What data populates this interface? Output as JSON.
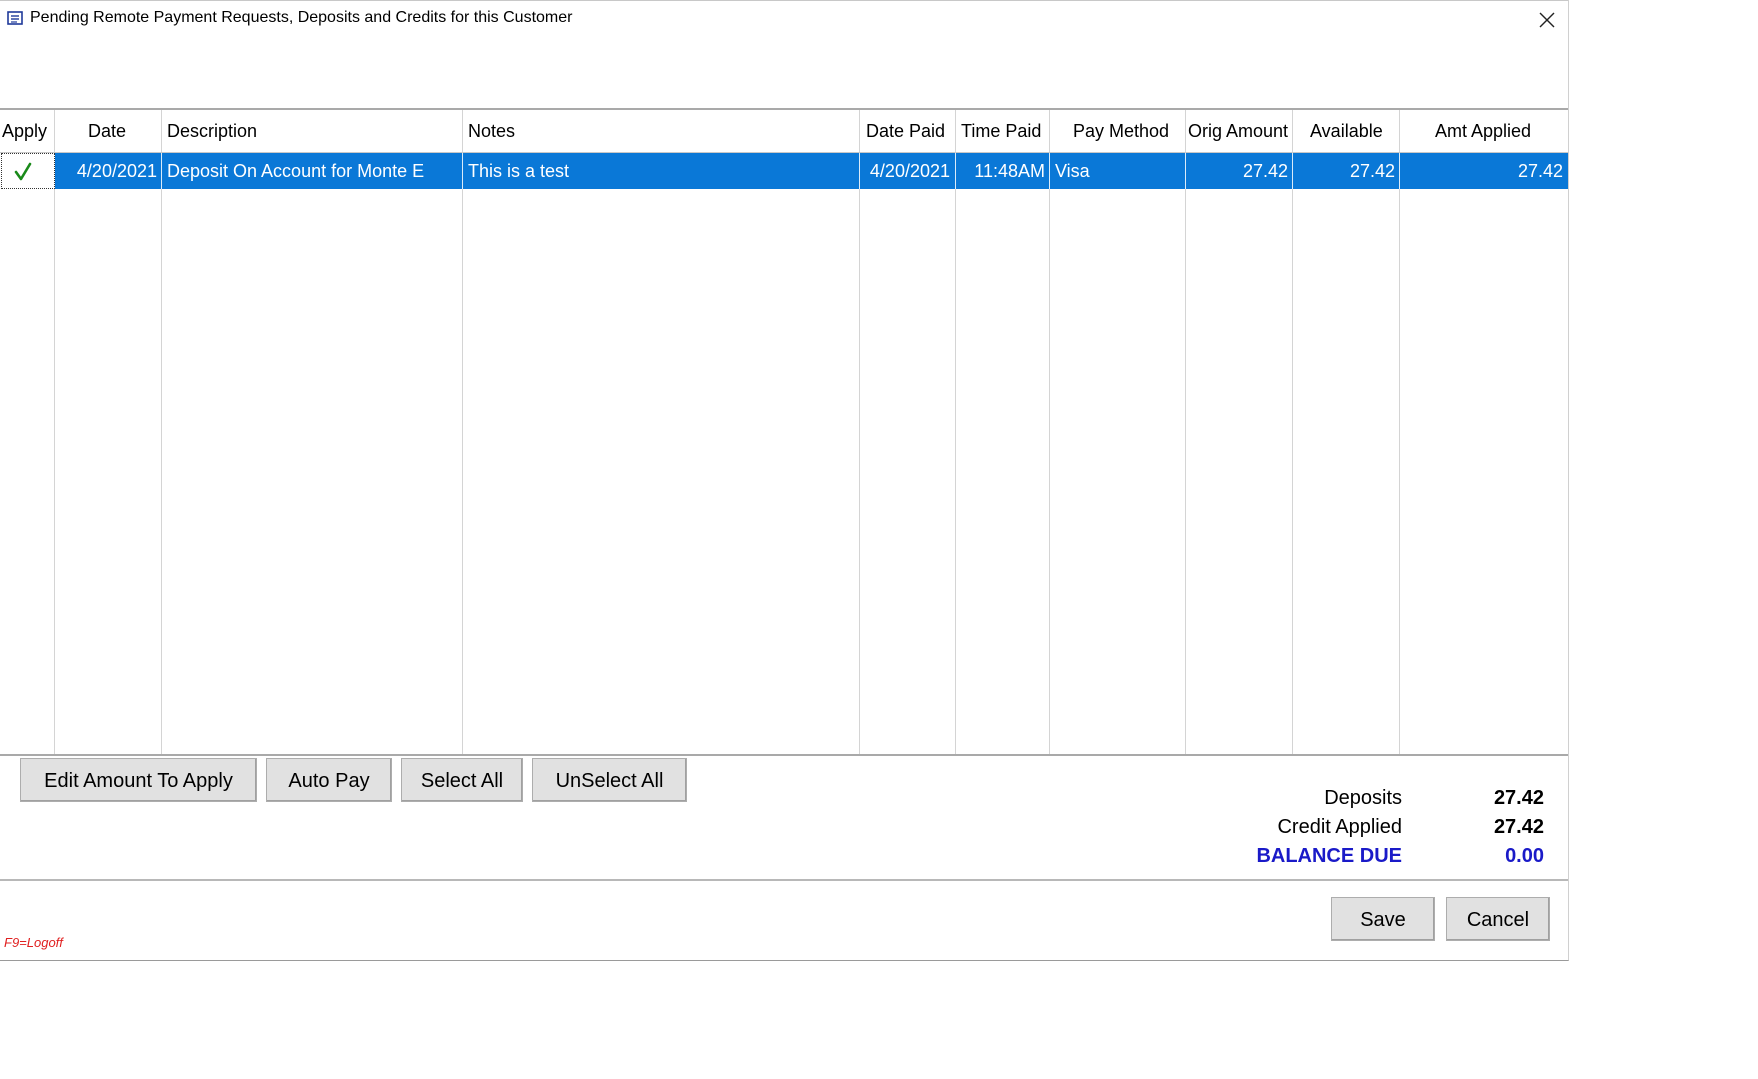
{
  "window": {
    "title": "Pending Remote Payment Requests, Deposits and Credits for this Customer",
    "icon": "app-window-icon",
    "close_icon": "close-icon"
  },
  "grid": {
    "columns": [
      "Apply",
      "Date",
      "Description",
      "Notes",
      "Date Paid",
      "Time Paid",
      "Pay Method",
      "Orig Amount",
      "Available",
      "Amt Applied"
    ],
    "rows": [
      {
        "apply": true,
        "date": "4/20/2021",
        "description": "Deposit On Account for Monte E",
        "notes": "This is a test",
        "date_paid": "4/20/2021",
        "time_paid": "11:48AM",
        "pay_method": "Visa",
        "orig_amount": "27.42",
        "available": "27.42",
        "amt_applied": "27.42"
      }
    ],
    "selection_color": "#0a78d7",
    "check_color": "#1a8a1a"
  },
  "buttons": {
    "edit_amount": "Edit Amount To Apply",
    "auto_pay": "Auto Pay",
    "select_all": "Select All",
    "unselect_all": "UnSelect All",
    "save": "Save",
    "cancel": "Cancel"
  },
  "summary": {
    "deposits_label": "Deposits",
    "deposits_value": "27.42",
    "credit_label": "Credit Applied",
    "credit_value": "27.42",
    "balance_label": "BALANCE DUE",
    "balance_value": "0.00",
    "balance_color": "#1a1ac8"
  },
  "footer": {
    "logoff_hint": "F9=Logoff",
    "logoff_color": "#e02020"
  }
}
